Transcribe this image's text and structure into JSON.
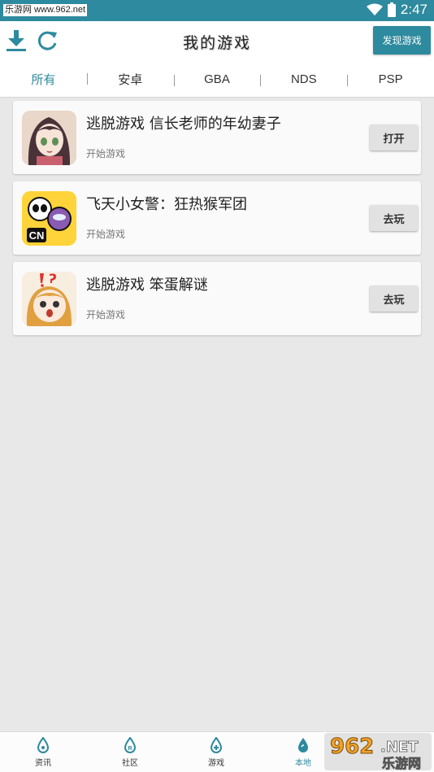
{
  "status_bar": {
    "watermark": "乐游网 www.962.net",
    "time": "2:47"
  },
  "header": {
    "title": "我的游戏",
    "discover_label": "发现游戏"
  },
  "tabs": [
    {
      "label": "所有",
      "active": true
    },
    {
      "label": "安卓",
      "active": false
    },
    {
      "label": "GBA",
      "active": false
    },
    {
      "label": "NDS",
      "active": false
    },
    {
      "label": "PSP",
      "active": false
    }
  ],
  "games": [
    {
      "title": "逃脱游戏 信长老师的年幼妻子",
      "subtitle": "开始游戏",
      "action": "打开",
      "icon": "anime-girl-icon"
    },
    {
      "title": "飞天小女警：狂热猴军团",
      "subtitle": "开始游戏",
      "action": "去玩",
      "icon": "powerpuff-icon"
    },
    {
      "title": "逃脱游戏 笨蛋解谜",
      "subtitle": "开始游戏",
      "action": "去玩",
      "icon": "surprised-girl-icon"
    }
  ],
  "bottom_nav": [
    {
      "label": "资讯",
      "active": false
    },
    {
      "label": "社区",
      "active": false
    },
    {
      "label": "游戏",
      "active": false
    },
    {
      "label": "本地",
      "active": true
    }
  ],
  "watermark": {
    "number": "962",
    "suffix": ".NET",
    "name": "乐游网"
  },
  "colors": {
    "accent": "#2e8a9e",
    "background": "#e8e8e8"
  }
}
